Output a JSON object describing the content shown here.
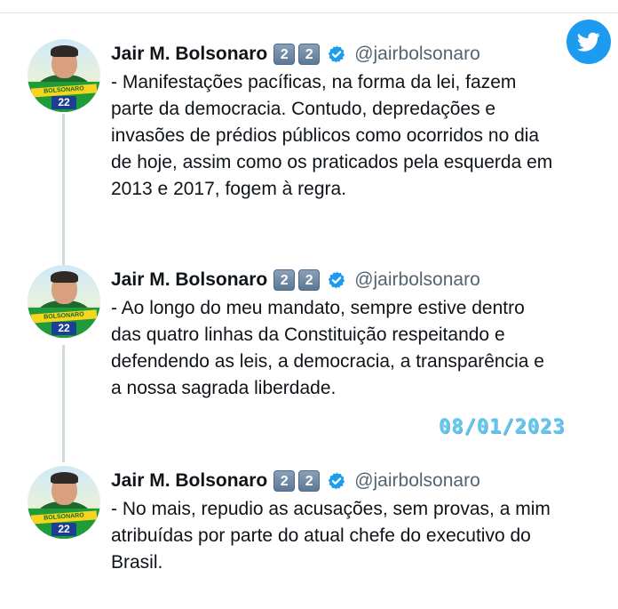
{
  "tweets": [
    {
      "author": "Jair M. Bolsonaro",
      "keycap_1": "2",
      "keycap_2": "2",
      "handle": "@jairbolsonaro",
      "text": "- Manifestações pacíficas, na forma da lei, fazem\nparte da democracia. Contudo, depredações e\ninvasões de prédios públicos como ocorridos no dia\nde hoje, assim como os praticados pela esquerda em\n2013 e 2017, fogem à regra."
    },
    {
      "author": "Jair M. Bolsonaro",
      "keycap_1": "2",
      "keycap_2": "2",
      "handle": "@jairbolsonaro",
      "text": "- Ao longo do meu mandato, sempre estive dentro\ndas quatro linhas da Constituição respeitando e\ndefendendo as leis, a democracia, a transparência e\na nossa sagrada liberdade."
    },
    {
      "author": "Jair M. Bolsonaro",
      "keycap_1": "2",
      "keycap_2": "2",
      "handle": "@jairbolsonaro",
      "text": "- No mais, repudio as acusações, sem provas, a mim\natribuídas por parte do atual chefe do executivo do\nBrasil."
    }
  ],
  "avatar": {
    "band_text": "BOLSONARO",
    "number": "22"
  },
  "date_overlay": "08/01/2023",
  "icons": {
    "logo": "twitter-bird-icon",
    "verified": "verified-badge-icon"
  },
  "colors": {
    "twitter_blue": "#1d9bf0",
    "text": "#0f1419",
    "muted": "#536471",
    "date": "#5ec6ee"
  }
}
